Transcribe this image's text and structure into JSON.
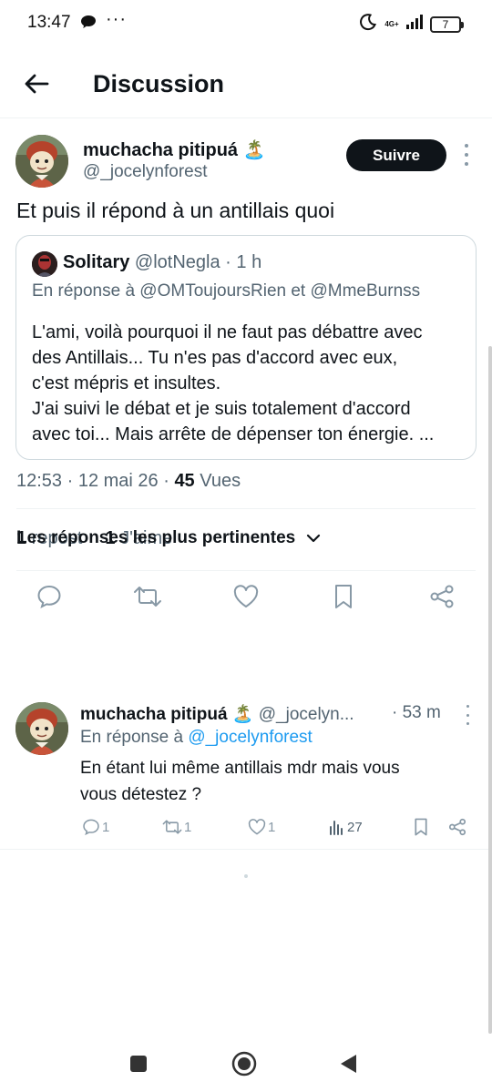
{
  "status_bar": {
    "time": "13:47",
    "dots": "···",
    "network": "4G+",
    "battery": "7"
  },
  "header": {
    "back_icon": "arrow-left-icon",
    "title": "Discussion"
  },
  "main_tweet": {
    "author_name": "muchacha pitipuá 🏝️",
    "author_handle": "@_jocelynforest",
    "follow_label": "Suivre",
    "text": "Et puis il répond à un antillais quoi",
    "quote": {
      "author_name": "Solitary",
      "author_handle": "@lotNegla",
      "time": "· 1 h",
      "reply_to": "En réponse à @OMToujoursRien et @MmeBurnss",
      "body_lines": [
        "L'ami, voilà pourquoi il ne faut pas débattre avec",
        "des Antillais... Tu n'es pas d'accord avec eux,",
        "c'est mépris et insultes.",
        "J'ai suivi le débat et je suis totalement d'accord",
        "avec toi... Mais arrête de dépenser ton énergie. ..."
      ]
    },
    "meta": {
      "time": "12:53 · 12 mai 26 · ",
      "views_count": "45",
      "views_label": " Vues"
    },
    "stats": {
      "reposts_count": "1",
      "reposts_label": " repost",
      "likes_count": "1",
      "likes_label": " J'aime"
    },
    "actions": [
      "reply-icon",
      "retweet-icon",
      "like-icon",
      "bookmark-icon",
      "share-icon"
    ]
  },
  "sort": {
    "label": "Les réponses les plus pertinentes"
  },
  "reply": {
    "author_name": "muchacha pitipuá 🏝️",
    "author_handle": "@_jocelyn...",
    "time": "· 53 m",
    "reply_to_prefix": "En réponse à ",
    "reply_to_handle": "@_jocelynforest",
    "text_lines": [
      "En étant lui même antillais mdr mais vous",
      "vous détestez ?"
    ],
    "counts": {
      "replies": "1",
      "retweets": "1",
      "likes": "1",
      "views": "27"
    }
  },
  "colors": {
    "accent": "#1d9bf0",
    "text": "#0f1419",
    "secondary": "#536471",
    "follow_bg": "#0f1419"
  }
}
